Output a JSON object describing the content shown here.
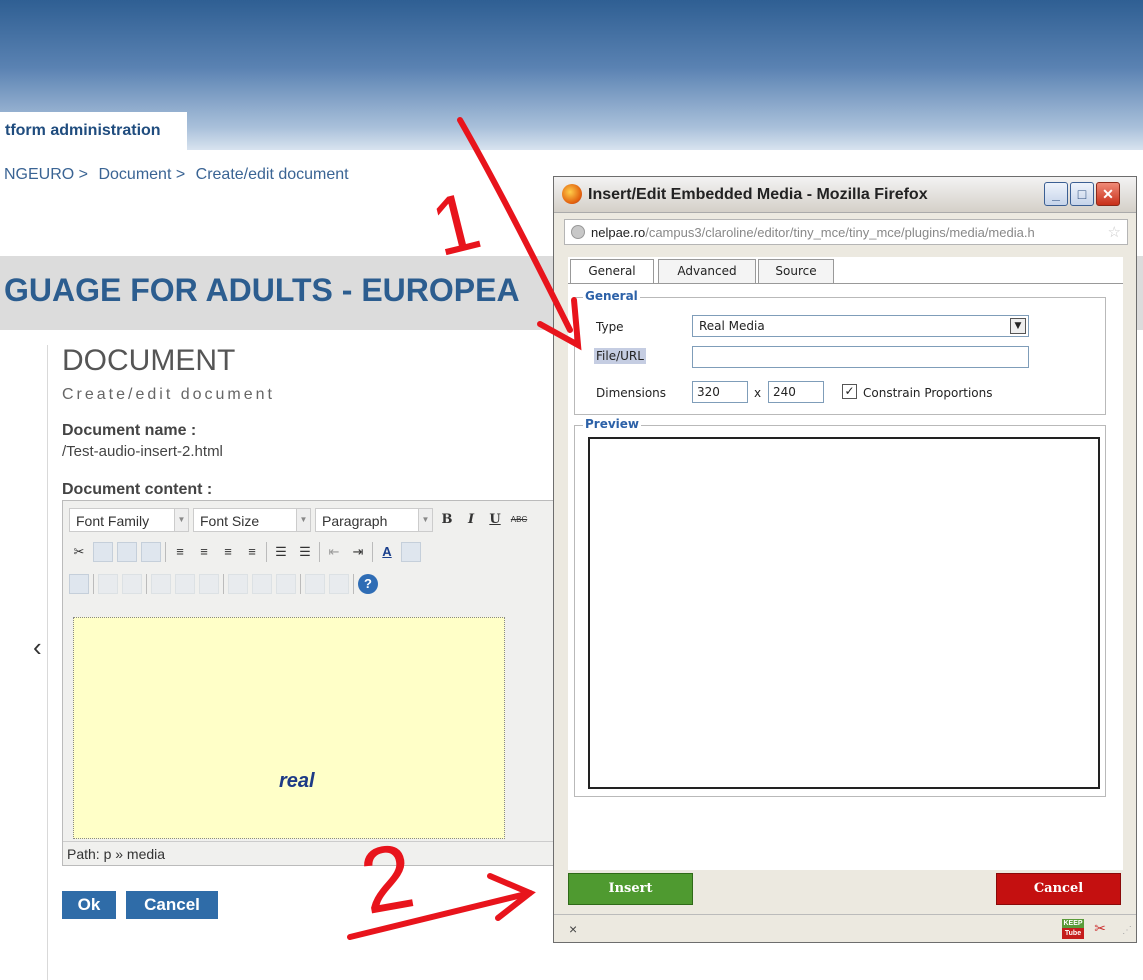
{
  "page": {
    "admin_tab": "tform administration",
    "breadcrumb": [
      "NGEURO >",
      "Document >",
      "Create/edit document"
    ],
    "course_title": "GUAGE FOR ADULTS - EUROPEA",
    "doc_title": "DOCUMENT",
    "doc_subtitle": "Create/edit document",
    "doc_name_label": "Document name :",
    "doc_name_value": "/Test-audio-insert-2.html",
    "doc_content_label": "Document content :",
    "nav_prev": "‹"
  },
  "editor": {
    "font_family": "Font Family",
    "font_size": "Font Size",
    "paragraph": "Paragraph",
    "bold": "B",
    "italic": "I",
    "underline": "U",
    "strike": "ABC",
    "media_placeholder": "real",
    "path_label": "Path: p » media"
  },
  "form_buttons": {
    "ok": "Ok",
    "cancel": "Cancel"
  },
  "popup": {
    "window_title": "Insert/Edit Embedded Media - Mozilla Firefox",
    "url_host": "nelpae.ro",
    "url_path": "/campus3/claroline/editor/tiny_mce/tiny_mce/plugins/media/media.h",
    "tabs": [
      "General",
      "Advanced",
      "Source"
    ],
    "general_legend": "General",
    "type_label": "Type",
    "type_value": "Real Media",
    "file_url_label": "File/URL",
    "file_url_value": "",
    "dimensions_label": "Dimensions",
    "width": "320",
    "times": "x",
    "height": "240",
    "constrain_label": "Constrain Proportions",
    "constrain_checked": true,
    "preview_legend": "Preview",
    "insert_button": "Insert",
    "cancel_button": "Cancel",
    "status_close": "×",
    "keep_icon_text": "KEEP Tube"
  },
  "annotations": {
    "label_1": "1",
    "label_2": "2",
    "color": "#e8141c"
  }
}
